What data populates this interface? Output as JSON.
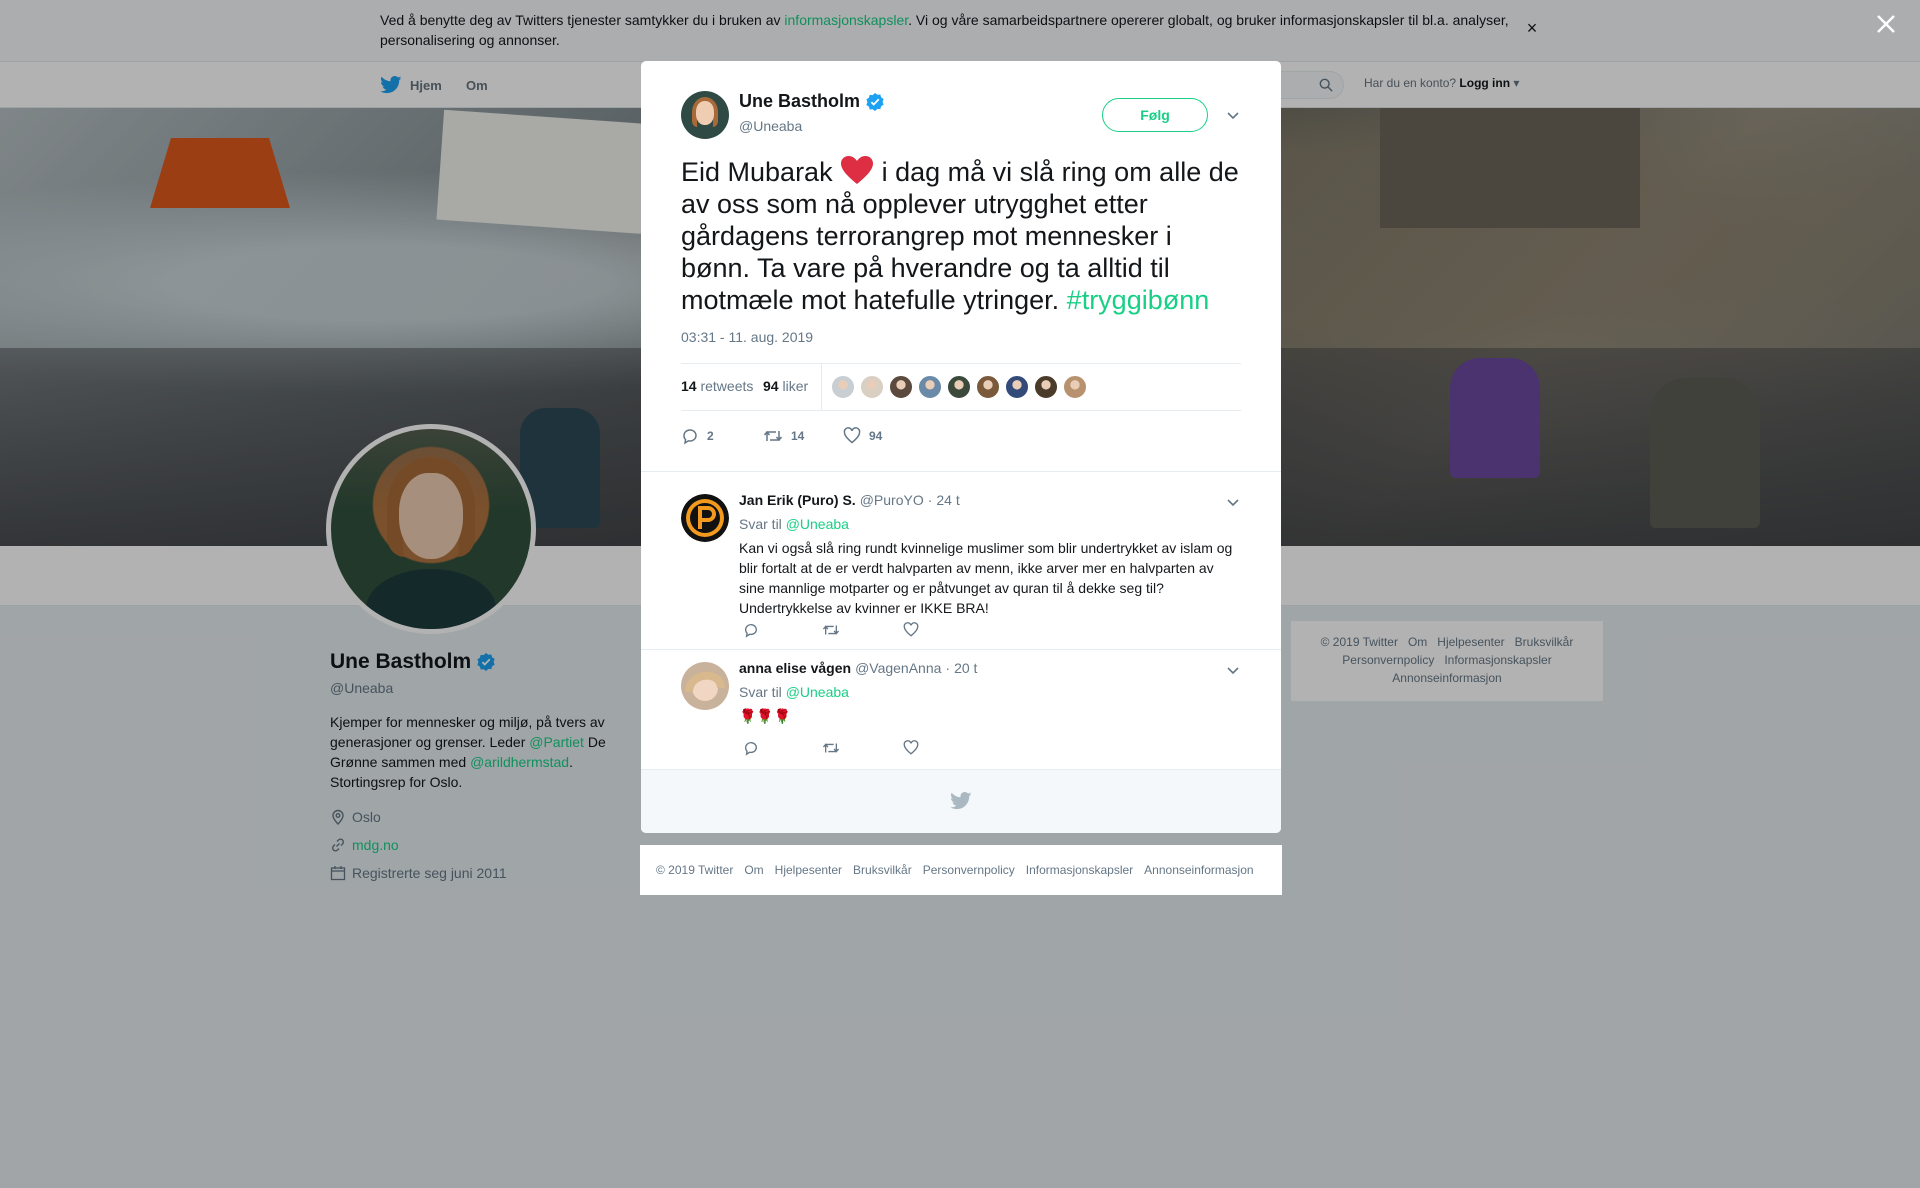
{
  "cookie_banner": {
    "text_before": "Ved å benytte deg av Twitters tjenester samtykker du i bruken av ",
    "link": "informasjonskapsler",
    "text_after": ". Vi og våre samarbeidspartnere opererer globalt, og bruker informasjonskapsler til bl.a. analyser, personalisering og annonser.",
    "close": "×"
  },
  "topnav": {
    "home": "Hjem",
    "about": "Om",
    "login_prompt": "Har du en konto?",
    "login": "Logg inn"
  },
  "profile": {
    "name": "Une Bastholm",
    "handle": "@Uneaba",
    "bio_1": "Kjemper for mennesker og miljø, på tvers av generasjoner og grenser. Leder ",
    "bio_link_1": "@Partiet",
    "bio_2": " De Grønne sammen med ",
    "bio_link_2": "@arildhermstad",
    "bio_3": ". Stortingsrep for Oslo.",
    "location": "Oslo",
    "website": "mdg.no",
    "joined": "Registrerte seg juni 2011"
  },
  "side_footer": [
    "© 2019 Twitter",
    "Om",
    "Hjelpesenter",
    "Bruksvilkår",
    "Personvernpolicy",
    "Informasjonskapsler",
    "Annonseinformasjon"
  ],
  "tweet": {
    "author_name": "Une Bastholm",
    "author_handle": "@Uneaba",
    "follow": "Følg",
    "text_1": "Eid Mubarak ",
    "text_2": " i dag må vi slå ring om alle de av oss som nå opplever utrygghet etter gårdagens terrorangrep mot mennesker i bønn. Ta vare på hverandre og ta alltid til motmæle mot hatefulle ytringer. ",
    "hashtag": "#tryggibønn",
    "timestamp": "03:31 - 11. aug. 2019",
    "retweets_count": "14",
    "retweets_label": "retweets",
    "likes_count": "94",
    "likes_label": "liker",
    "reply_count": "2",
    "retweet_action_count": "14",
    "like_action_count": "94",
    "liker_colors": [
      "#c9ced3",
      "#d9cfc3",
      "#5b4a3d",
      "#6a8aa8",
      "#3b4a3b",
      "#7a5a3a",
      "#344a78",
      "#4b3b2b",
      "#b8926e"
    ]
  },
  "replies": [
    {
      "name": "Jan Erik (Puro) S.",
      "handle": "@PuroYO",
      "time": "24 t",
      "to_label": "Svar til",
      "to_handle": "@Uneaba",
      "text": "Kan vi også slå ring rundt kvinnelige muslimer som blir undertrykket av islam og blir fortalt at de er verdt halvparten av menn, ikke arver mer en halvparten av sine mannlige motparter og er påtvunget av quran til å dekke seg til? Undertrykkelse av kvinner er IKKE BRA!"
    },
    {
      "name": "anna elise vågen",
      "handle": "@VagenAnna",
      "time": "20 t",
      "to_label": "Svar til",
      "to_handle": "@Uneaba",
      "text": "🌹🌹🌹"
    }
  ],
  "bottom_footer": [
    "© 2019 Twitter",
    "Om",
    "Hjelpesenter",
    "Bruksvilkår",
    "Personvernpolicy",
    "Informasjonskapsler",
    "Annonseinformasjon"
  ],
  "colors": {
    "accent": "#19cf86",
    "verified": "#1da1f2",
    "heart": "#e0245e"
  }
}
